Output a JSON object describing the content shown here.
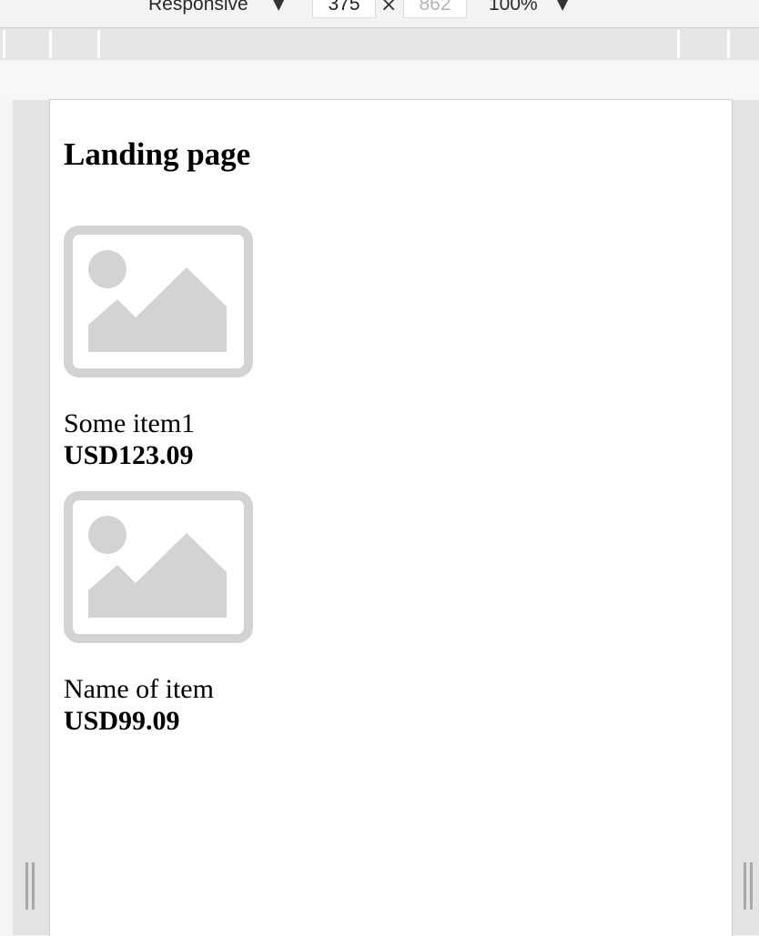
{
  "toolbar": {
    "device_label": "Responsive",
    "width_value": "375",
    "height_value": "862",
    "times_symbol": "×",
    "zoom_label": "100%",
    "dropdown_arrow": "▼"
  },
  "page": {
    "heading": "Landing page",
    "products": [
      {
        "name": "Some item1",
        "price": "USD123.09",
        "image_icon": "image-placeholder-icon"
      },
      {
        "name": "Name of item",
        "price": "USD99.09",
        "image_icon": "image-placeholder-icon"
      }
    ]
  },
  "colors": {
    "placeholder_gray": "#d3d3d3",
    "viewport_bg": "#ffffff",
    "toolbar_bg": "#f3f3f3",
    "mq_bar_bg": "#e6e6e6",
    "gutter_bg": "#e3e3e3"
  }
}
